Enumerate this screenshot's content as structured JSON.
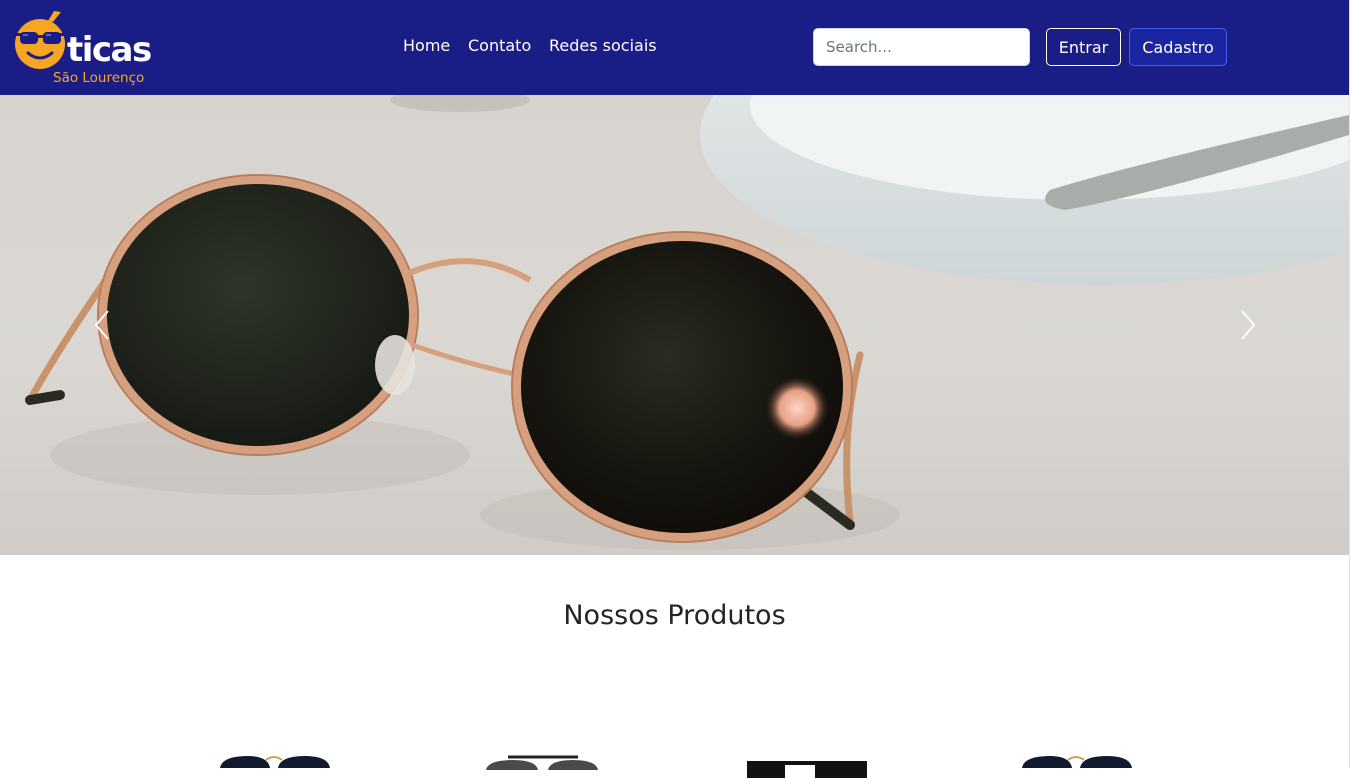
{
  "brand": {
    "logo_text": "ticas",
    "logo_subtitle": "São Lourenço",
    "colors": {
      "navbar": "#1b1d87",
      "accent": "#f6a623"
    }
  },
  "nav": {
    "links": [
      "Home",
      "Contato",
      "Redes sociais"
    ]
  },
  "search": {
    "placeholder": "Search..."
  },
  "auth": {
    "login_label": "Entrar",
    "signup_label": "Cadastro"
  },
  "hero": {
    "prev_icon": "chevron-left-icon",
    "next_icon": "chevron-right-icon"
  },
  "products": {
    "title": "Nossos Produtos",
    "items": [
      "sunglasses-gold-round",
      "sunglasses-aviator-black",
      "sunglasses-black-square",
      "sunglasses-gold-round"
    ]
  }
}
